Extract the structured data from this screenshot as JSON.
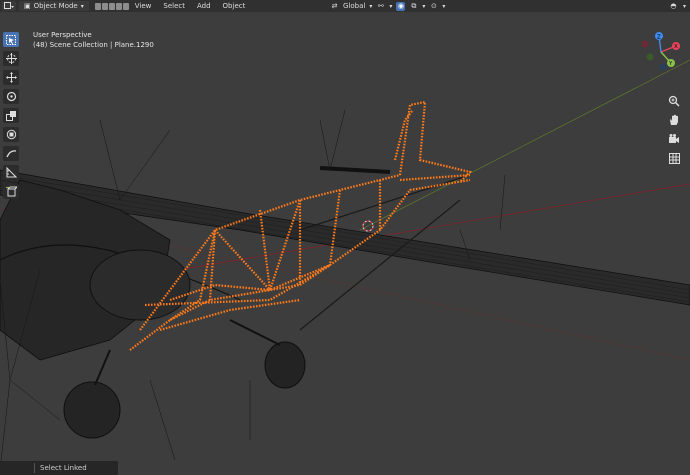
{
  "header": {
    "mode_label": "Object Mode",
    "menus": [
      "View",
      "Select",
      "Add",
      "Object"
    ],
    "transform_orientation": "Global",
    "editor_icon": "3d-viewport-icon",
    "selection_mode_icons": [
      "select-new-icon",
      "select-extend-icon",
      "select-subtract-icon",
      "select-difference-icon",
      "select-intersect-icon"
    ]
  },
  "viewport": {
    "perspective_label": "User Perspective",
    "collection_label": "(48) Scene Collection | Plane.1290",
    "gizmo_axes": [
      "X",
      "Y",
      "Z"
    ]
  },
  "toolbar": {
    "tools": [
      "select-box-icon",
      "cursor-icon",
      "move-icon",
      "rotate-icon",
      "scale-icon",
      "transform-icon",
      "annotate-icon",
      "measure-icon",
      "add-cube-icon"
    ]
  },
  "nav_icons": [
    "zoom-icon",
    "pan-hand-icon",
    "camera-icon",
    "grid-icon"
  ],
  "status_bar": {
    "label": "Select Linked"
  },
  "colors": {
    "accent": "#4772b3",
    "selection": "#ff7a1a",
    "axis_x": "#e4455c",
    "axis_y": "#8bc34a",
    "axis_z": "#3f8cf0",
    "viewport_bg": "#3d3d3d"
  }
}
